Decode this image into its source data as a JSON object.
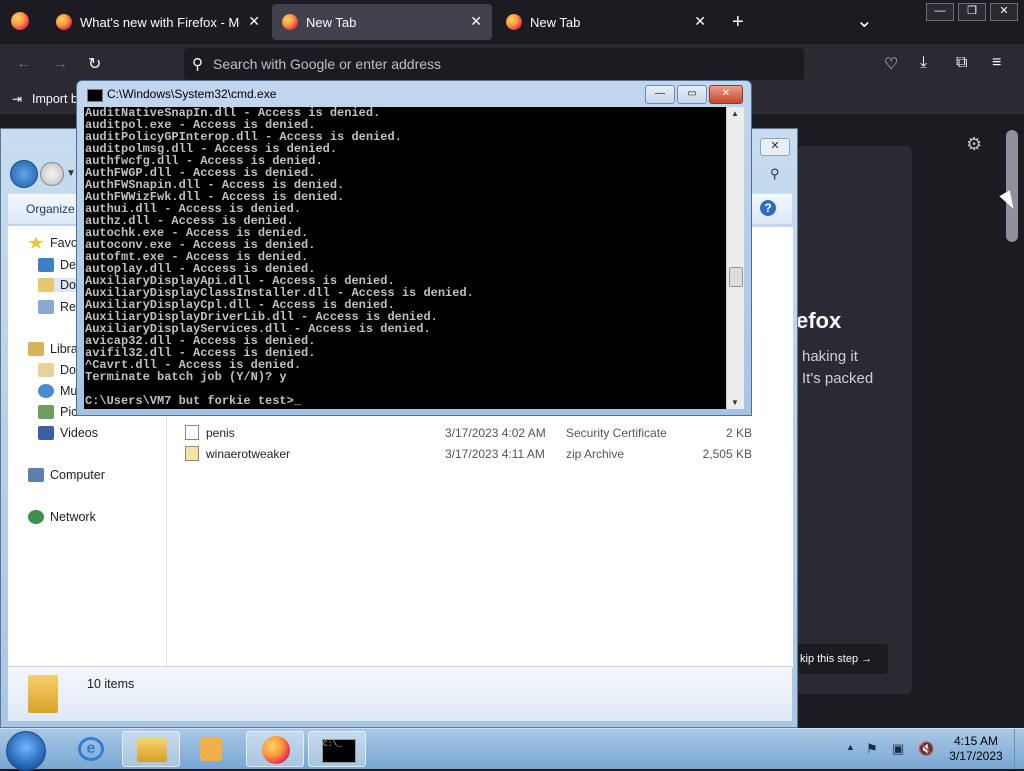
{
  "firefox": {
    "tabs": [
      {
        "title": "What's new with Firefox - More",
        "close": "✕"
      },
      {
        "title": "New Tab",
        "close": "✕"
      },
      {
        "title": "New Tab",
        "close": "✕"
      }
    ],
    "new_tab": "+",
    "tab_overflow": "⌄",
    "window_controls": [
      "—",
      "❐",
      "✕"
    ],
    "url_placeholder": "Search with Google or enter address",
    "bookmark_item": "Import b",
    "welcome": {
      "title_fragment": "efox",
      "text_lines": [
        "haking it",
        "It's packed"
      ],
      "skip_label": "kip this step →"
    }
  },
  "explorer": {
    "organize": "Organize",
    "nav": {
      "favorites": "Favo",
      "desktop": "Des",
      "downloads": "Do",
      "recent": "Rec",
      "libraries": "Libra",
      "documents": "Do",
      "music": "Mu",
      "pictures": "Pic",
      "videos": "Videos",
      "computer": "Computer",
      "network": "Network"
    },
    "files": [
      {
        "name": "penis",
        "date": "3/17/2023 4:02 AM",
        "type": "Security Certificate",
        "size": "2 KB"
      },
      {
        "name": "winaerotweaker",
        "date": "3/17/2023 4:11 AM",
        "type": "zip Archive",
        "size": "2,505 KB"
      }
    ],
    "status": "10 items",
    "help": "?"
  },
  "cmd": {
    "title": "C:\\Windows\\System32\\cmd.exe",
    "controls": [
      "—",
      "▭",
      "✕"
    ],
    "lines": [
      "AuditNativeSnapIn.dll - Access is denied.",
      "auditpol.exe - Access is denied.",
      "auditPolicyGPInterop.dll - Access is denied.",
      "auditpolmsg.dll - Access is denied.",
      "authfwcfg.dll - Access is denied.",
      "AuthFWGP.dll - Access is denied.",
      "AuthFWSnapin.dll - Access is denied.",
      "AuthFWWizFwk.dll - Access is denied.",
      "authui.dll - Access is denied.",
      "authz.dll - Access is denied.",
      "autochk.exe - Access is denied.",
      "autoconv.exe - Access is denied.",
      "autofmt.exe - Access is denied.",
      "autoplay.dll - Access is denied.",
      "AuxiliaryDisplayApi.dll - Access is denied.",
      "AuxiliaryDisplayClassInstaller.dll - Access is denied.",
      "AuxiliaryDisplayCpl.dll - Access is denied.",
      "AuxiliaryDisplayDriverLib.dll - Access is denied.",
      "AuxiliaryDisplayServices.dll - Access is denied.",
      "avicap32.dll - Access is denied.",
      "avifil32.dll - Access is denied.",
      "^Cavrt.dll - Access is denied.",
      "Terminate batch job (Y/N)? y",
      "",
      "C:\\Users\\VM7 but forkie test>_"
    ]
  },
  "taskbar": {
    "time": "4:15 AM",
    "date": "3/17/2023",
    "tray_arrow": "▲"
  }
}
